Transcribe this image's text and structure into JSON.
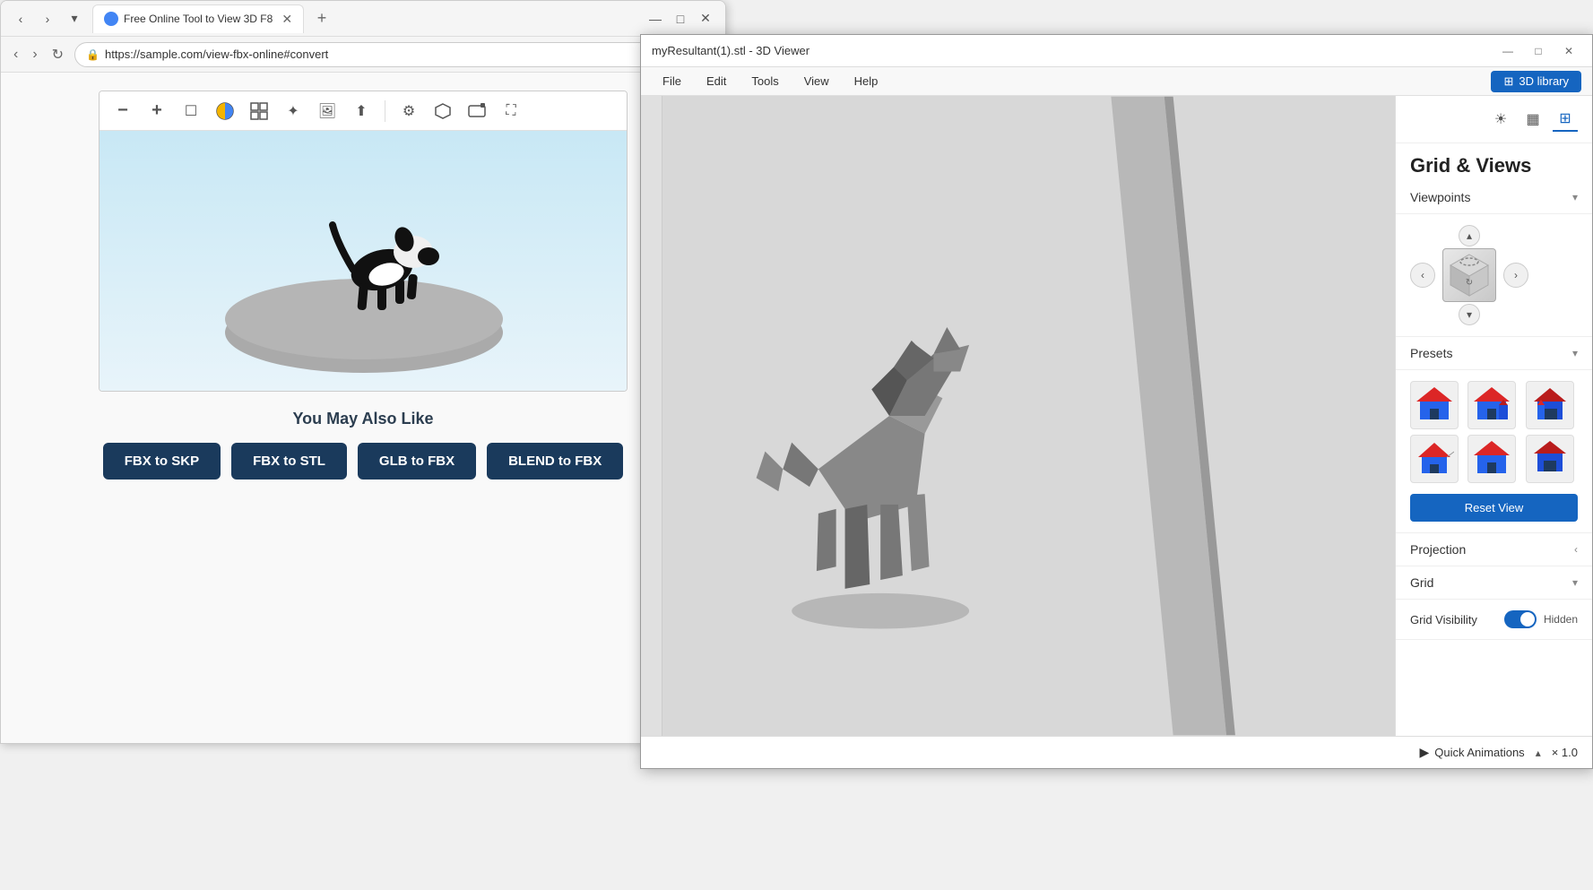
{
  "browser": {
    "title": "Free Online Tool to View 3D F8",
    "url": "https://sample.com/view-fbx-online#convert",
    "tab_label": "Free Online Tool to View 3D F8",
    "new_tab_label": "+",
    "nav": {
      "back_label": "‹",
      "forward_label": "›",
      "refresh_label": "↻"
    },
    "viewer": {
      "toolbar_buttons": [
        {
          "name": "zoom-out",
          "icon": "−"
        },
        {
          "name": "zoom-in",
          "icon": "+"
        },
        {
          "name": "box-select",
          "icon": "□"
        },
        {
          "name": "color-palette",
          "icon": "◉"
        },
        {
          "name": "grid-view",
          "icon": "⊞"
        },
        {
          "name": "brightness",
          "icon": "✦"
        },
        {
          "name": "image",
          "icon": "🖼"
        },
        {
          "name": "upload",
          "icon": "⬆"
        },
        {
          "name": "settings",
          "icon": "⚙"
        },
        {
          "name": "cube-view",
          "icon": "◻"
        },
        {
          "name": "camera",
          "icon": "▣"
        },
        {
          "name": "fullscreen",
          "icon": "⛶"
        }
      ]
    },
    "also_like": {
      "title": "You May Also Like",
      "buttons": [
        {
          "label": "FBX to SKP"
        },
        {
          "label": "FBX to STL"
        },
        {
          "label": "GLB to FBX"
        },
        {
          "label": "BLEND to FBX"
        }
      ]
    }
  },
  "viewer_app": {
    "title": "myResultant(1).stl - 3D Viewer",
    "menu": [
      "File",
      "Edit",
      "Tools",
      "View",
      "Help"
    ],
    "library_btn": "3D library",
    "panel": {
      "title": "Grid & Views",
      "sections": {
        "viewpoints": {
          "label": "Viewpoints",
          "expanded": true
        },
        "presets": {
          "label": "Presets",
          "expanded": true
        },
        "reset_view": "Reset View",
        "projection": {
          "label": "Projection",
          "expanded": false
        },
        "grid": {
          "label": "Grid",
          "expanded": true,
          "visibility_label": "Grid Visibility",
          "status": "Hidden"
        }
      }
    },
    "bottombar": {
      "quick_animations_label": "Quick Animations",
      "speed_label": "× 1.0"
    }
  }
}
